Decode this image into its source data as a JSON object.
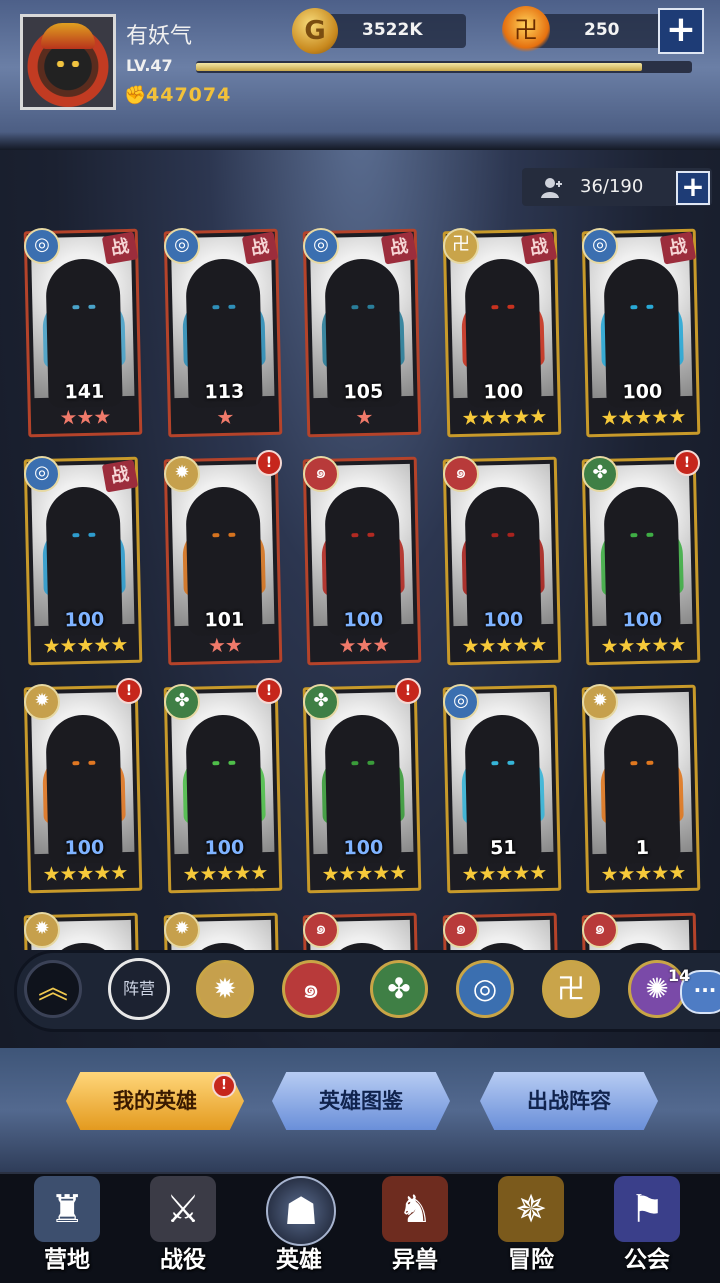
{
  "colors": {
    "gold": "#c89a2a",
    "red_frame": "#b5432a",
    "star_gold": "#f6c93a",
    "star_red": "#f07a6a",
    "alert": "#c6261c",
    "tab_active": "#e39a1f",
    "tab_inactive": "#6a8fd9"
  },
  "player": {
    "name": "有妖气",
    "level_label": "LV.47",
    "xp_fraction": 0.9,
    "power_icon": "power-fist-icon",
    "power": "447074"
  },
  "resources": {
    "gold_icon": "G",
    "gold": "3522K",
    "fire_icon": "卍",
    "fire": "250",
    "plus": "+"
  },
  "roster": {
    "count": "36/190",
    "plus": "+"
  },
  "heroes": [
    {
      "level": "141",
      "stars": 3,
      "star_color": "red",
      "faction": "water",
      "fight": true,
      "alert": false,
      "frame": "red",
      "shiny": false,
      "accent": "#4aa3c9"
    },
    {
      "level": "113",
      "stars": 1,
      "star_color": "red",
      "faction": "water",
      "fight": true,
      "alert": false,
      "frame": "red",
      "shiny": false,
      "accent": "#2f8fb8"
    },
    {
      "level": "105",
      "stars": 1,
      "star_color": "red",
      "faction": "water",
      "fight": true,
      "alert": false,
      "frame": "red",
      "shiny": false,
      "accent": "#2a7e9a"
    },
    {
      "level": "100",
      "stars": 5,
      "star_color": "gold",
      "faction": "earth",
      "fight": true,
      "alert": false,
      "frame": "gold",
      "shiny": false,
      "accent": "#c8321f"
    },
    {
      "level": "100",
      "stars": 5,
      "star_color": "gold",
      "faction": "water",
      "fight": true,
      "alert": false,
      "frame": "gold",
      "shiny": false,
      "accent": "#29a9d6"
    },
    {
      "level": "100",
      "stars": 5,
      "star_color": "gold",
      "faction": "water",
      "fight": true,
      "alert": false,
      "frame": "gold",
      "shiny": true,
      "accent": "#2e9ccd"
    },
    {
      "level": "101",
      "stars": 2,
      "star_color": "red",
      "faction": "sun",
      "fight": false,
      "alert": true,
      "frame": "red",
      "shiny": false,
      "accent": "#d5731f"
    },
    {
      "level": "100",
      "stars": 3,
      "star_color": "red",
      "faction": "fire",
      "fight": false,
      "alert": false,
      "frame": "red",
      "shiny": true,
      "accent": "#b22a22"
    },
    {
      "level": "100",
      "stars": 5,
      "star_color": "gold",
      "faction": "fire",
      "fight": false,
      "alert": false,
      "frame": "gold",
      "shiny": true,
      "accent": "#a8231e"
    },
    {
      "level": "100",
      "stars": 5,
      "star_color": "gold",
      "faction": "wood",
      "fight": false,
      "alert": true,
      "frame": "gold",
      "shiny": true,
      "accent": "#3fae45"
    },
    {
      "level": "100",
      "stars": 5,
      "star_color": "gold",
      "faction": "sun",
      "fight": false,
      "alert": true,
      "frame": "gold",
      "shiny": true,
      "accent": "#e07722"
    },
    {
      "level": "100",
      "stars": 5,
      "star_color": "gold",
      "faction": "wood",
      "fight": false,
      "alert": true,
      "frame": "gold",
      "shiny": true,
      "accent": "#4fbf4a"
    },
    {
      "level": "100",
      "stars": 5,
      "star_color": "gold",
      "faction": "wood",
      "fight": false,
      "alert": true,
      "frame": "gold",
      "shiny": true,
      "accent": "#3a9c3a"
    },
    {
      "level": "51",
      "stars": 5,
      "star_color": "gold",
      "faction": "water",
      "fight": false,
      "alert": false,
      "frame": "gold",
      "shiny": false,
      "accent": "#36b5d8"
    },
    {
      "level": "1",
      "stars": 5,
      "star_color": "gold",
      "faction": "sun",
      "fight": false,
      "alert": false,
      "frame": "gold",
      "shiny": false,
      "accent": "#e0781f"
    },
    {
      "level": "",
      "stars": 0,
      "star_color": "gold",
      "faction": "sun",
      "fight": false,
      "alert": false,
      "frame": "gold",
      "shiny": false,
      "accent": "#d8772a"
    },
    {
      "level": "",
      "stars": 0,
      "star_color": "gold",
      "faction": "sun",
      "fight": false,
      "alert": false,
      "frame": "gold",
      "shiny": false,
      "accent": "#d8772a"
    },
    {
      "level": "",
      "stars": 0,
      "star_color": "gold",
      "faction": "fire",
      "fight": false,
      "alert": false,
      "frame": "red",
      "shiny": false,
      "accent": "#b22a22"
    },
    {
      "level": "",
      "stars": 0,
      "star_color": "gold",
      "faction": "fire",
      "fight": false,
      "alert": false,
      "frame": "red",
      "shiny": false,
      "accent": "#b22a22"
    },
    {
      "level": "",
      "stars": 0,
      "star_color": "gold",
      "faction": "fire",
      "fight": false,
      "alert": false,
      "frame": "red",
      "shiny": false,
      "accent": "#b22a22"
    }
  ],
  "fight_tag": "战",
  "alert_mark": "!",
  "factions": {
    "water": {
      "icon": "wave-icon",
      "glyph": "◎",
      "bg": "#3b6fb0"
    },
    "earth": {
      "icon": "earth-rune-icon",
      "glyph": "卍",
      "bg": "#c9a44a"
    },
    "sun": {
      "icon": "sun-icon",
      "glyph": "✹",
      "bg": "#c6a04c"
    },
    "fire": {
      "icon": "flame-spiral-icon",
      "glyph": "๑",
      "bg": "#b83a3a"
    },
    "wood": {
      "icon": "leaf-icon",
      "glyph": "✤",
      "bg": "#3f7f45"
    }
  },
  "filters": {
    "collapse_icon": "︽",
    "camp_label": "阵营",
    "buttons": [
      {
        "faction": "sun",
        "glyph": "✹",
        "bg": "#c6a04c"
      },
      {
        "faction": "fire",
        "glyph": "๑",
        "bg": "#b83a3a"
      },
      {
        "faction": "wood",
        "glyph": "✤",
        "bg": "#3f7f45"
      },
      {
        "faction": "water",
        "glyph": "◎",
        "bg": "#3b6fb0"
      },
      {
        "faction": "earth",
        "glyph": "卍",
        "bg": "#c9a44a"
      },
      {
        "faction": "arcane",
        "glyph": "✺",
        "bg": "#7a4aa8"
      }
    ],
    "chat_count": "14",
    "chat_icon": "···"
  },
  "tabs": {
    "my_heroes": "我的英雄",
    "codex": "英雄图鉴",
    "lineup": "出战阵容",
    "alert": "!"
  },
  "nav": [
    {
      "label": "营地",
      "icon": "castle-icon",
      "glyph": "♜",
      "bg": "#3d4f6e",
      "active": false
    },
    {
      "label": "战役",
      "icon": "crossed-swords-icon",
      "glyph": "⚔",
      "bg": "#3b3b46",
      "active": false
    },
    {
      "label": "英雄",
      "icon": "helmet-icon",
      "glyph": "☗",
      "bg": "#2a3348",
      "active": true
    },
    {
      "label": "异兽",
      "icon": "beast-icon",
      "glyph": "♞",
      "bg": "#6e2c1f",
      "active": false
    },
    {
      "label": "冒险",
      "icon": "compass-icon",
      "glyph": "✵",
      "bg": "#7b5a1c",
      "active": false
    },
    {
      "label": "公会",
      "icon": "guild-banner-icon",
      "glyph": "⚑",
      "bg": "#3a3f8a",
      "active": false
    }
  ]
}
